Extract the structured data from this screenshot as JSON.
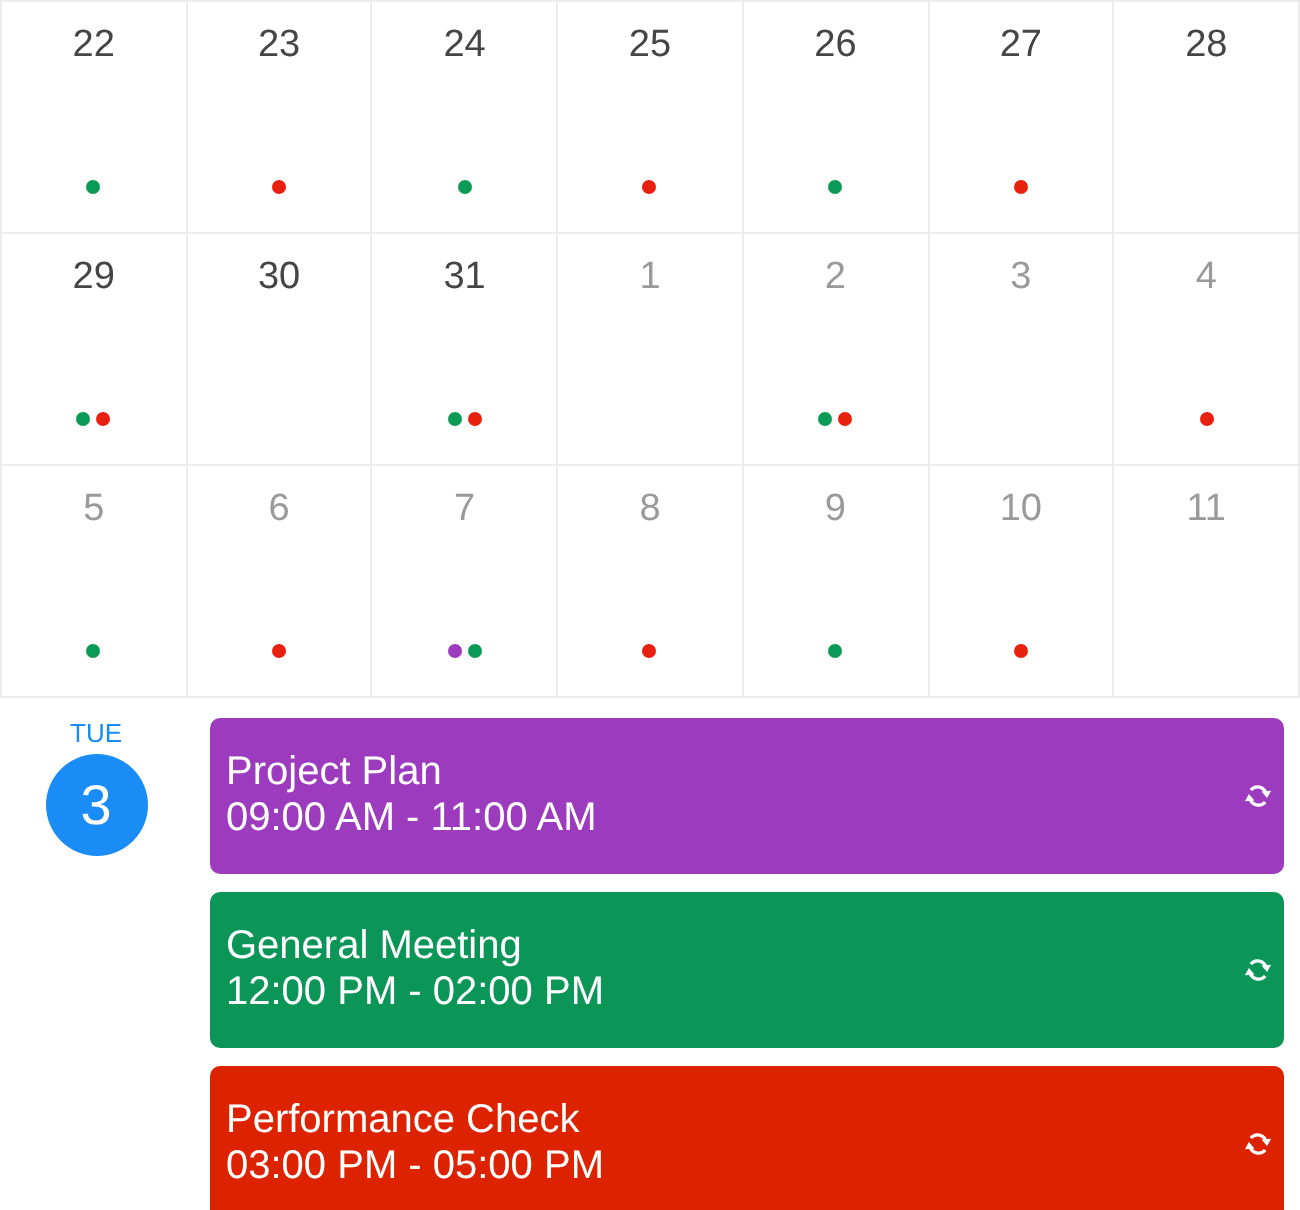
{
  "calendar": {
    "weeks": [
      [
        {
          "day": "22",
          "muted": false,
          "dots": [
            {
              "color": "#0b9a55"
            }
          ]
        },
        {
          "day": "23",
          "muted": false,
          "dots": [
            {
              "color": "#e8200e"
            }
          ]
        },
        {
          "day": "24",
          "muted": false,
          "dots": [
            {
              "color": "#0b9a55"
            }
          ]
        },
        {
          "day": "25",
          "muted": false,
          "dots": [
            {
              "color": "#e8200e"
            }
          ]
        },
        {
          "day": "26",
          "muted": false,
          "dots": [
            {
              "color": "#0b9a55"
            }
          ]
        },
        {
          "day": "27",
          "muted": false,
          "dots": [
            {
              "color": "#e8200e"
            }
          ]
        },
        {
          "day": "28",
          "muted": false
        }
      ],
      [
        {
          "day": "29",
          "muted": false,
          "dots": [
            {
              "color": "#0b9a55"
            },
            {
              "color": "#e8200e"
            }
          ]
        },
        {
          "day": "30",
          "muted": false
        },
        {
          "day": "31",
          "muted": false,
          "dots": [
            {
              "color": "#0b9a55"
            },
            {
              "color": "#e8200e"
            }
          ]
        },
        {
          "day": "1",
          "muted": true
        },
        {
          "day": "2",
          "muted": true,
          "dots": [
            {
              "color": "#0b9a55"
            },
            {
              "color": "#e8200e"
            }
          ]
        },
        {
          "day": "3",
          "muted": true
        },
        {
          "day": "4",
          "muted": true,
          "dots": [
            {
              "color": "#e8200e"
            }
          ]
        }
      ],
      [
        {
          "day": "5",
          "muted": true,
          "dots": [
            {
              "color": "#0b9a55"
            }
          ]
        },
        {
          "day": "6",
          "muted": true,
          "dots": [
            {
              "color": "#e8200e"
            }
          ]
        },
        {
          "day": "7",
          "muted": true,
          "dots": [
            {
              "color": "#9c3bbd"
            },
            {
              "color": "#0b9a55"
            }
          ]
        },
        {
          "day": "8",
          "muted": true,
          "dots": [
            {
              "color": "#e8200e"
            }
          ]
        },
        {
          "day": "9",
          "muted": true,
          "dots": [
            {
              "color": "#0b9a55"
            }
          ]
        },
        {
          "day": "10",
          "muted": true,
          "dots": [
            {
              "color": "#e8200e"
            }
          ]
        },
        {
          "day": "11",
          "muted": true
        }
      ]
    ]
  },
  "agenda": {
    "weekday": "TUE",
    "day": "3",
    "events": [
      {
        "title": "Project Plan",
        "time": "09:00 AM - 11:00 AM",
        "color": "#9c3bbd",
        "recurring": true
      },
      {
        "title": "General Meeting",
        "time": "12:00 PM - 02:00 PM",
        "color": "#0b9557",
        "recurring": true
      },
      {
        "title": "Performance Check",
        "time": "03:00 PM - 05:00 PM",
        "color": "#dd2200",
        "recurring": true
      }
    ]
  }
}
